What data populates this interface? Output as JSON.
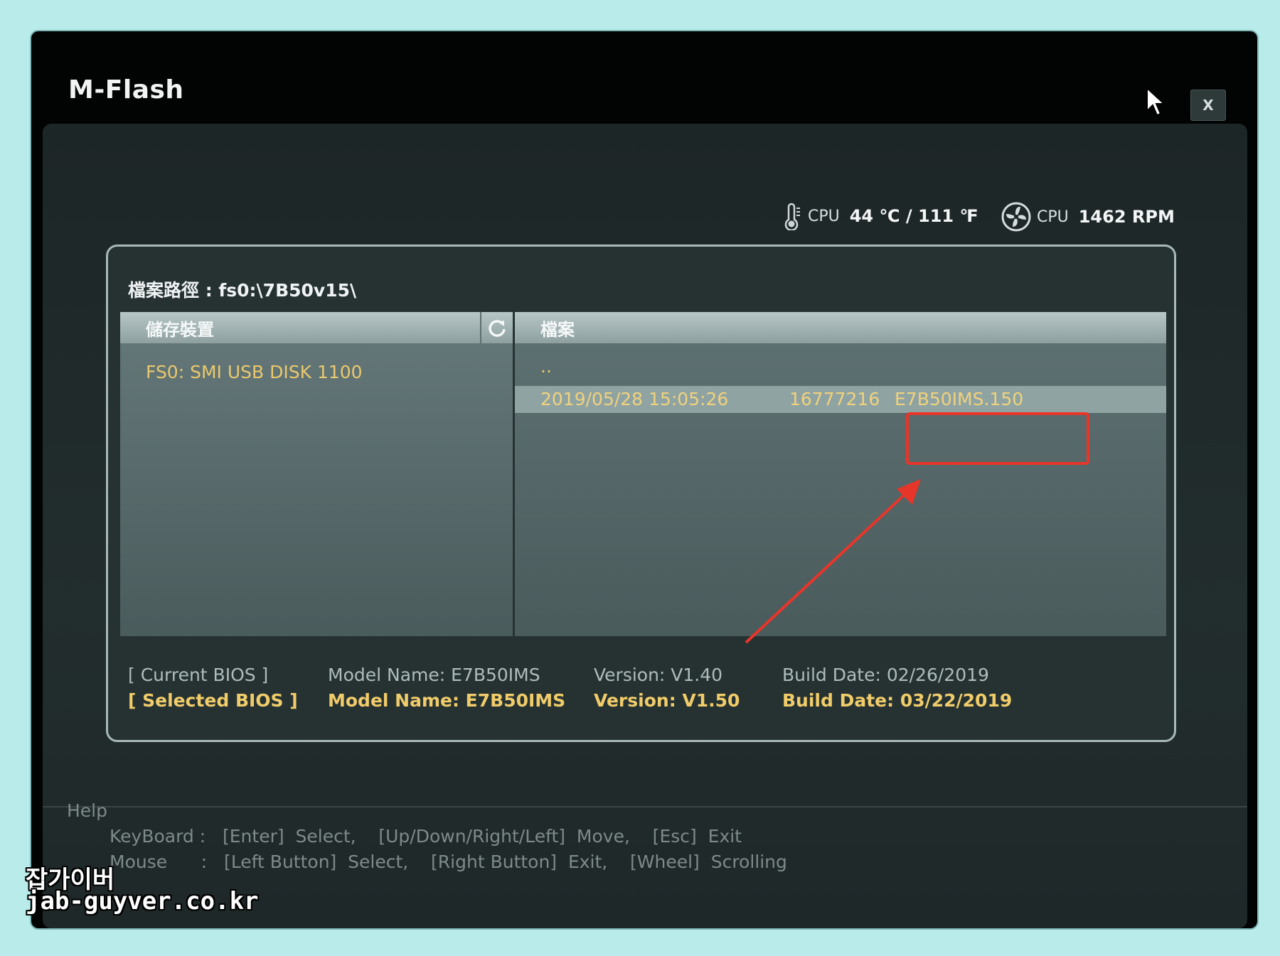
{
  "app": {
    "title": "M-Flash",
    "close_label": "X"
  },
  "status": {
    "temp_label": "CPU",
    "temp_value": "44 ℃ / 111 ℉",
    "fan_label": "CPU",
    "fan_value": "1462 RPM"
  },
  "path": {
    "text": "檔案路徑 : fs0:\\7B50v15\\"
  },
  "storage": {
    "header": "儲存裝置",
    "items": [
      {
        "label": "FS0: SMI USB DISK 1100"
      }
    ]
  },
  "files": {
    "header": "檔案",
    "parent": "..",
    "rows": [
      {
        "date": "2019/05/28 15:05:26",
        "size": "16777216",
        "name": "E7B50IMS.150"
      }
    ]
  },
  "bios": {
    "current": {
      "tag": "[ Current BIOS    ]",
      "model": "Model Name: E7B50IMS",
      "version": "Version: V1.40",
      "build": "Build Date: 02/26/2019"
    },
    "selected": {
      "tag": "[ Selected BIOS ]",
      "model": "Model Name: E7B50IMS",
      "version": "Version: V1.50",
      "build": "Build Date: 03/22/2019"
    }
  },
  "help": {
    "title": "Help",
    "keyboard": "KeyBoard :   [Enter]  Select,    [Up/Down/Right/Left]  Move,    [Esc]  Exit",
    "mouse": "Mouse      :   [Left Button]  Select,    [Right Button]  Exit,    [Wheel]  Scrolling"
  },
  "watermark": {
    "line1": "잡가이버",
    "line2": "jab-guyver.co.kr"
  },
  "colors": {
    "accent_yellow": "#eac86e",
    "highlight_red": "#e8352a",
    "background": "#b9ebea"
  }
}
